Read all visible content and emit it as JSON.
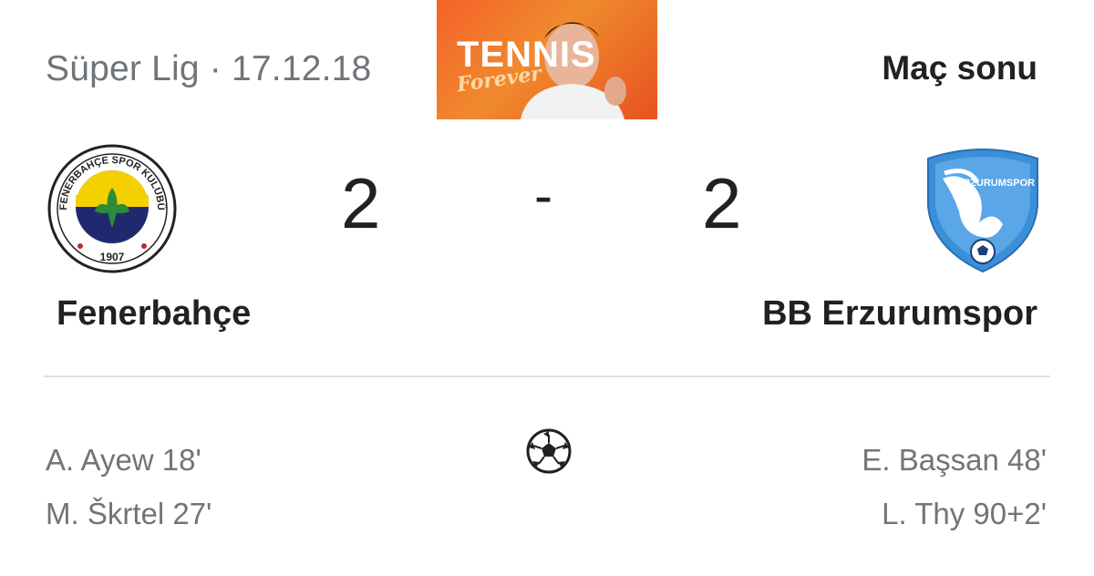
{
  "header": {
    "league_date": "Süper Lig · 17.12.18",
    "status": "Maç sonu"
  },
  "ad": {
    "brand": "TENNIS",
    "script": "Forever"
  },
  "home": {
    "name": "Fenerbahçe",
    "score": "2",
    "logo_text_top": "FENERBAHÇE SPOR KULÜBÜ",
    "logo_year": "1907",
    "scorers": [
      "A. Ayew 18'",
      "M. Škrtel 27'"
    ]
  },
  "separator": "-",
  "away": {
    "name": "BB Erzurumspor",
    "score": "2",
    "logo_text": "ERZURUMSPOR",
    "scorers": [
      "E. Başsan 48'",
      "L. Thy 90+2'"
    ]
  },
  "icons": {
    "goals": "soccer-ball-icon"
  },
  "colors": {
    "home_yellow": "#f5d000",
    "home_navy": "#1f2a6e",
    "away_blue": "#3b8fd8",
    "ad_orange": "#f4622a"
  }
}
